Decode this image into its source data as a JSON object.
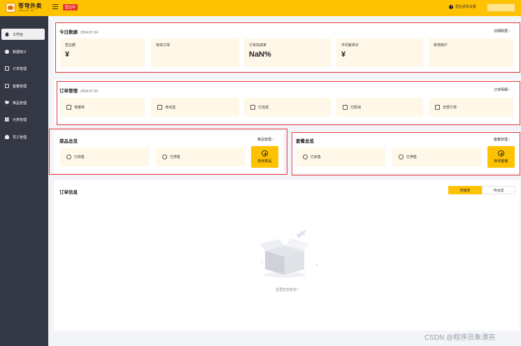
{
  "app": {
    "logo_main": "苍穹外卖",
    "logo_sub": "TAKE OUT · SKY",
    "status_badge": "营业中",
    "shop_setting": "营业状态设置"
  },
  "sidebar": {
    "items": [
      {
        "label": "工作台",
        "icon": "home-icon"
      },
      {
        "label": "数据统计",
        "icon": "chart-icon"
      },
      {
        "label": "订单管理",
        "icon": "order-icon"
      },
      {
        "label": "套餐管理",
        "icon": "setmeal-icon"
      },
      {
        "label": "菜品管理",
        "icon": "dish-icon"
      },
      {
        "label": "分类管理",
        "icon": "category-icon"
      },
      {
        "label": "员工管理",
        "icon": "employee-icon"
      }
    ]
  },
  "today": {
    "title": "今日数据",
    "date": "2024.07.04",
    "link": "详细数据",
    "cards": [
      {
        "label": "营业额",
        "value": "¥"
      },
      {
        "label": "有效订单",
        "value": ""
      },
      {
        "label": "订单完成率",
        "value": "NaN%"
      },
      {
        "label": "平均客单价",
        "value": "¥"
      },
      {
        "label": "新增用户",
        "value": ""
      }
    ]
  },
  "orders": {
    "title": "订单管理",
    "date": "2024.07.04",
    "link": "订单明细",
    "cards": [
      "待接单",
      "待派送",
      "已完成",
      "已取消",
      "全部订单"
    ]
  },
  "dishes": {
    "title": "菜品总览",
    "link": "菜品管理",
    "on_sale": "已启售",
    "off_sale": "已停售",
    "add_label": "新增菜品"
  },
  "setmeals": {
    "title": "套餐总览",
    "link": "套餐管理",
    "on_sale": "已启售",
    "off_sale": "已停售",
    "add_label": "新增套餐"
  },
  "order_info": {
    "title": "订单信息",
    "tabs": [
      "待接单",
      "待派送"
    ],
    "empty_text": "这里空空如也~"
  },
  "watermark": "CSDN @程序员象漂亮",
  "colors": {
    "accent": "#ffc200",
    "sidebar_bg": "#343744",
    "highlight_border": "#e8333a",
    "card_bg": "#fff8e9",
    "status_red": "#e8302e"
  }
}
